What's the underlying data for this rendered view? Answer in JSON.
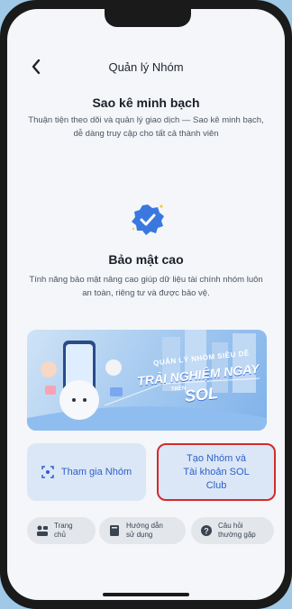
{
  "header": {
    "title": "Quản lý Nhóm"
  },
  "section1": {
    "title": "Sao kê minh bạch",
    "desc": "Thuận tiện theo dõi và quản lý giao dịch — Sao kê minh bạch, dễ dàng truy cập cho tất cả thành viên"
  },
  "section2": {
    "title": "Bảo mật cao",
    "desc": "Tính năng bảo mật nâng cao giúp dữ liệu tài chính nhóm luôn an toàn, riêng tư và được bảo vệ."
  },
  "banner": {
    "line1": "QUẢN LÝ NHÓM SIÊU DỄ",
    "line2": "TRẢI NGHIỆM NGAY",
    "line3": "TRÊN",
    "line4": "SOL"
  },
  "actions": {
    "join": "Tham gia Nhóm",
    "create_line1": "Tạo Nhóm và",
    "create_line2": "Tài khoản SOL",
    "create_line3": "Club"
  },
  "quicklinks": {
    "home_line1": "Trang",
    "home_line2": "chủ",
    "guide_line1": "Hướng dẫn",
    "guide_line2": "sử dụng",
    "faq_line1": "Câu hỏi",
    "faq_line2": "thường gặp"
  },
  "colors": {
    "accent": "#2c5fc9",
    "highlight_border": "#d52b2b"
  }
}
